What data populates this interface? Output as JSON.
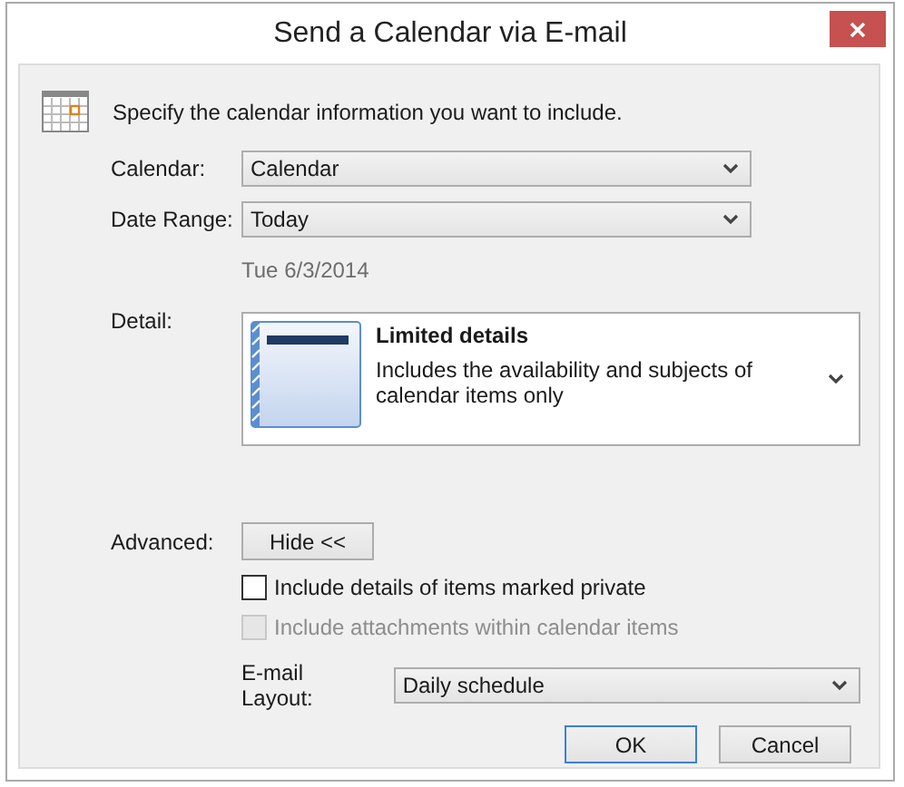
{
  "window": {
    "title": "Send a Calendar via E-mail"
  },
  "intro": "Specify the calendar information you want to include.",
  "fields": [
    {
      "label": "Calendar:",
      "value": "Calendar"
    },
    {
      "label": "Date Range:",
      "value": "Today"
    }
  ],
  "date_note": "Tue 6/3/2014",
  "detail": {
    "label": "Detail:",
    "title": "Limited details",
    "description": "Includes the availability and subjects of calendar items only"
  },
  "advanced": {
    "label": "Advanced:",
    "button": "Hide <<"
  },
  "options": [
    {
      "label": "Include details of items marked private",
      "checked": false,
      "disabled": false
    },
    {
      "label": "Include attachments within calendar items",
      "checked": false,
      "disabled": true
    }
  ],
  "layout": {
    "label": "E-mail Layout:",
    "value": "Daily schedule"
  },
  "buttons": [
    {
      "label": "OK",
      "default": true
    },
    {
      "label": "Cancel",
      "default": false
    }
  ]
}
